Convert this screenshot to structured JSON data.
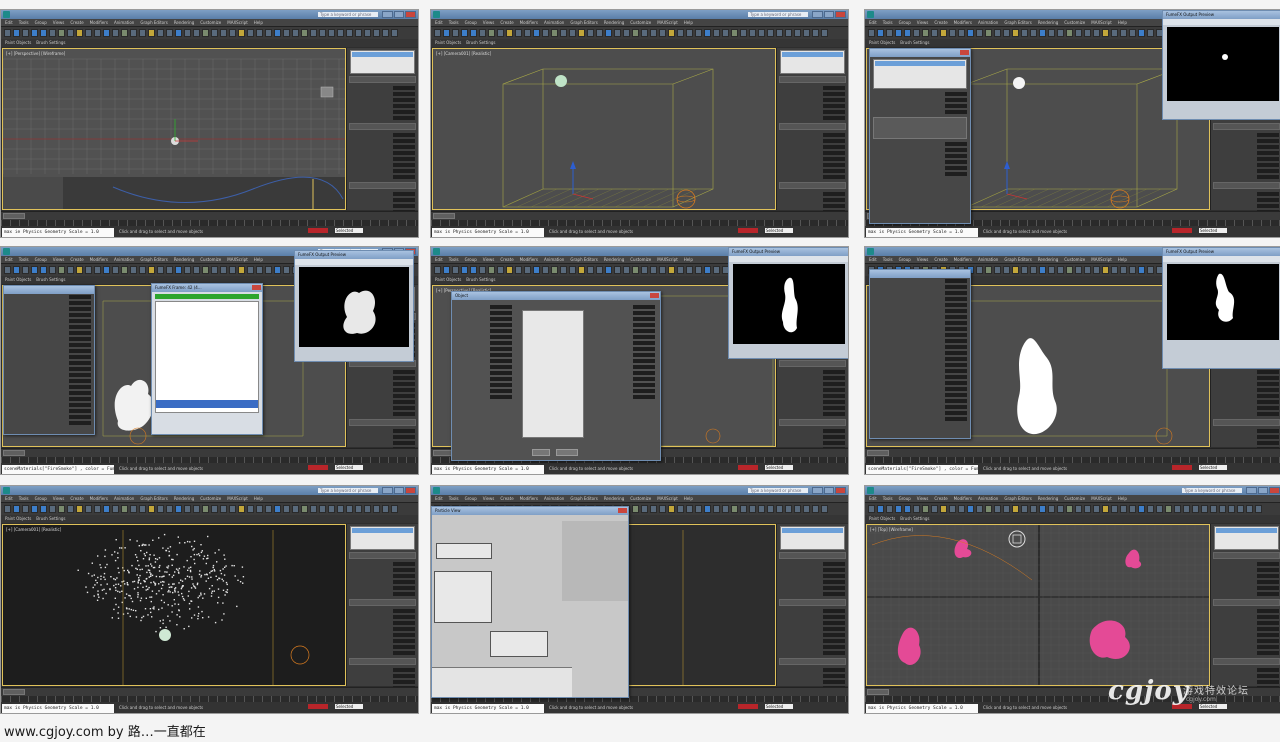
{
  "app": {
    "menu_items": [
      "Edit",
      "Tools",
      "Group",
      "Views",
      "Create",
      "Modifiers",
      "Animation",
      "Graph Editors",
      "Rendering",
      "Customize",
      "MAXScript",
      "Help"
    ],
    "search_placeholder": "Type a keyword or phrase",
    "subbar_items": [
      "Paint Objects",
      "Brush Settings"
    ],
    "status_message": "Click and drag to select and move objects",
    "key_set": "Selected"
  },
  "thumbnails": [
    {
      "viewport_label": "[+] [Perspective] [Wireframe]",
      "listener_text": "max ie Physics Geometry Scale = 1.0",
      "variant": "grid"
    },
    {
      "viewport_label": "[+] [Camera001] [Realistic]",
      "listener_text": "max is Physics Geometry Scale = 1.0",
      "variant": "box"
    },
    {
      "viewport_label": "[+] [Perspective] [Realistic]",
      "listener_text": "max is Physics Geometry Scale = 1.0",
      "variant": "source-dialog",
      "preview_title": "FumeFX Output Preview"
    },
    {
      "viewport_label": "[+] [Perspective] [Realistic]",
      "listener_text": "sceneMaterials[\"FireSmoke\"] , color = FumeFX",
      "variant": "smoke-sim",
      "dialog_title": "FumeFX Frame: 42 (4...",
      "preview_title": "FumeFX Output Preview"
    },
    {
      "viewport_label": "[+] [Perspective] [Realistic]",
      "listener_text": "max is Physics Geometry Scale = 1.0",
      "variant": "controller-dialog",
      "dialog_title": "Object",
      "preview_title": "FumeFX Output Preview"
    },
    {
      "viewport_label": "[+] [Perspective] [Realistic]",
      "listener_text": "sceneMaterials[\"FireSmoke\"] , color = FumeFX",
      "variant": "smoke-white",
      "preview_title": "FumeFX Output Preview"
    },
    {
      "viewport_label": "[+] [Camera001] [Realistic]",
      "listener_text": "max is Physics Geometry Scale = 1.0",
      "variant": "particles"
    },
    {
      "viewport_label": "[+] [Camera001] [Realistic]",
      "listener_text": "max is Physics Geometry Scale = 1.0",
      "variant": "particle-view",
      "dialog_title": "Particle View"
    },
    {
      "viewport_label": "[+] [Top] [Wireframe]",
      "listener_text": "max is Physics Geometry Scale = 1.0",
      "variant": "four-views"
    }
  ],
  "footer": {
    "credit": "www.cgjoy.com by 路…一直都在"
  },
  "watermark": {
    "logo": "cgjoy",
    "chinese": "游戏特效论坛",
    "sub": "cgjoy.com"
  }
}
